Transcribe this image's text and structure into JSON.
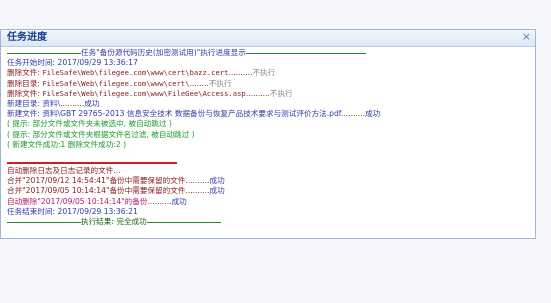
{
  "panel": {
    "title": "任务进度",
    "close_label": "×"
  },
  "log": {
    "header_text": "任务\"备份源代码历史(加密测试用)\"执行进度显示",
    "start_time_label": "任务开始时间:",
    "start_time_value": "2017/09/29 13:36:17",
    "delete_file_1_prefix": "删除文件:",
    "delete_file_1_path": "FileSafe\\Web\\filegee.com\\www\\cert\\bazz.cert",
    "delete_file_1_dots": "..........",
    "delete_file_1_status": "不执行",
    "delete_dir_prefix": "删除目录:",
    "delete_dir_path": "FileSafe\\Web\\filegee.com\\www\\cert\\",
    "delete_dir_dots": "........",
    "delete_dir_status": "不执行",
    "delete_file_2_prefix": "删除文件:",
    "delete_file_2_path": "FileSafe\\Web\\filegee.com\\www\\FileGee\\Access.asp",
    "delete_file_2_dots": "..........",
    "delete_file_2_status": "不执行",
    "new_dir_prefix": "新建目录:",
    "new_dir_path": "资料\\",
    "new_dir_dots": "..........",
    "new_dir_status": "成功",
    "new_file_prefix": "新建文件:",
    "new_file_path": "资料\\GBT 29765-2013 信息安全技术 数据备份与恢复产品技术要求与测试评价方法.pdf",
    "new_file_dots": "..........",
    "new_file_status": "成功",
    "hint_1": "( 提示: 部分文件或文件夹未被选中, 被自动跳过 )",
    "hint_2": "( 提示: 部分文件或文件夹根据文件名过滤, 被自动跳过 )",
    "summary": "( 新建文件成功:1 删除文件成功:2 )",
    "auto_delete_header": "自动删除日志及日志记录的文件...",
    "merge_1_text": "合并\"2017/09/12 14:54:41\"备份中需要保留的文件",
    "merge_1_dots": "..........",
    "merge_1_status": "成功",
    "merge_2_text": "合并\"2017/09/05 10:14:14\"备份中需要保留的文件",
    "merge_2_dots": "..........",
    "merge_2_status": "成功",
    "auto_delete_text": "自动删除\"2017/09/05 10:14:14\"的备份",
    "auto_delete_dots": "..........",
    "auto_delete_status": "成功",
    "end_time_label": "任务结束时间:",
    "end_time_value": "2017/09/29 13:36:21",
    "result_text": "执行结果: 完全成功"
  },
  "colors": {
    "title": "#15428b",
    "info_blue": "#2f3aa8",
    "delete_darkred": "#8b1a1a",
    "hint_green": "#1a9a2a",
    "separator_red": "#d61b1b",
    "merge_magenta": "#b21c6a"
  }
}
